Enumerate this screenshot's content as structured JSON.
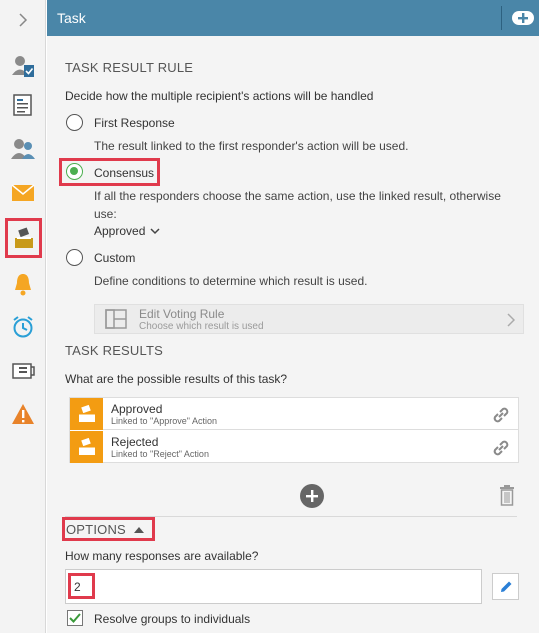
{
  "header": {
    "title": "Task"
  },
  "sidebar": {
    "items": [
      {
        "icon": "chevron-right-icon"
      },
      {
        "icon": "user-check-icon"
      },
      {
        "icon": "form-icon"
      },
      {
        "icon": "users-icon"
      },
      {
        "icon": "envelope-icon"
      },
      {
        "icon": "ballot-box-icon"
      },
      {
        "icon": "bell-icon"
      },
      {
        "icon": "alarm-clock-icon"
      },
      {
        "icon": "screen-icon"
      },
      {
        "icon": "warning-icon"
      }
    ]
  },
  "result_rule": {
    "title": "TASK RESULT RULE",
    "description": "Decide how the multiple recipient's actions will be handled",
    "options": [
      {
        "label": "First Response",
        "desc": "The result linked to the first responder's action will be used.",
        "checked": false
      },
      {
        "label": "Consensus",
        "desc_line1": "If all the responders choose the same action, use the linked result, otherwise",
        "desc_line2": "use:",
        "selected_value": "Approved",
        "checked": true
      },
      {
        "label": "Custom",
        "desc": "Define conditions to determine which result is used.",
        "checked": false
      }
    ],
    "voting": {
      "label": "Edit Voting Rule",
      "sub": "Choose which result is used"
    }
  },
  "task_results": {
    "title": "TASK RESULTS",
    "question": "What are the possible results of this task?",
    "rows": [
      {
        "name": "Approved",
        "link": "Linked to \"Approve\" Action"
      },
      {
        "name": "Rejected",
        "link": "Linked to \"Reject\" Action"
      }
    ]
  },
  "options": {
    "title": "OPTIONS",
    "question": "How many responses are available?",
    "responses_value": "2",
    "resolve_label": "Resolve groups to individuals",
    "resolve_checked": true
  },
  "colors": {
    "header": "#4a86a8",
    "accent_red": "#e03a4c",
    "result_icon": "#f39c12",
    "radio_green": "#4caf50"
  }
}
